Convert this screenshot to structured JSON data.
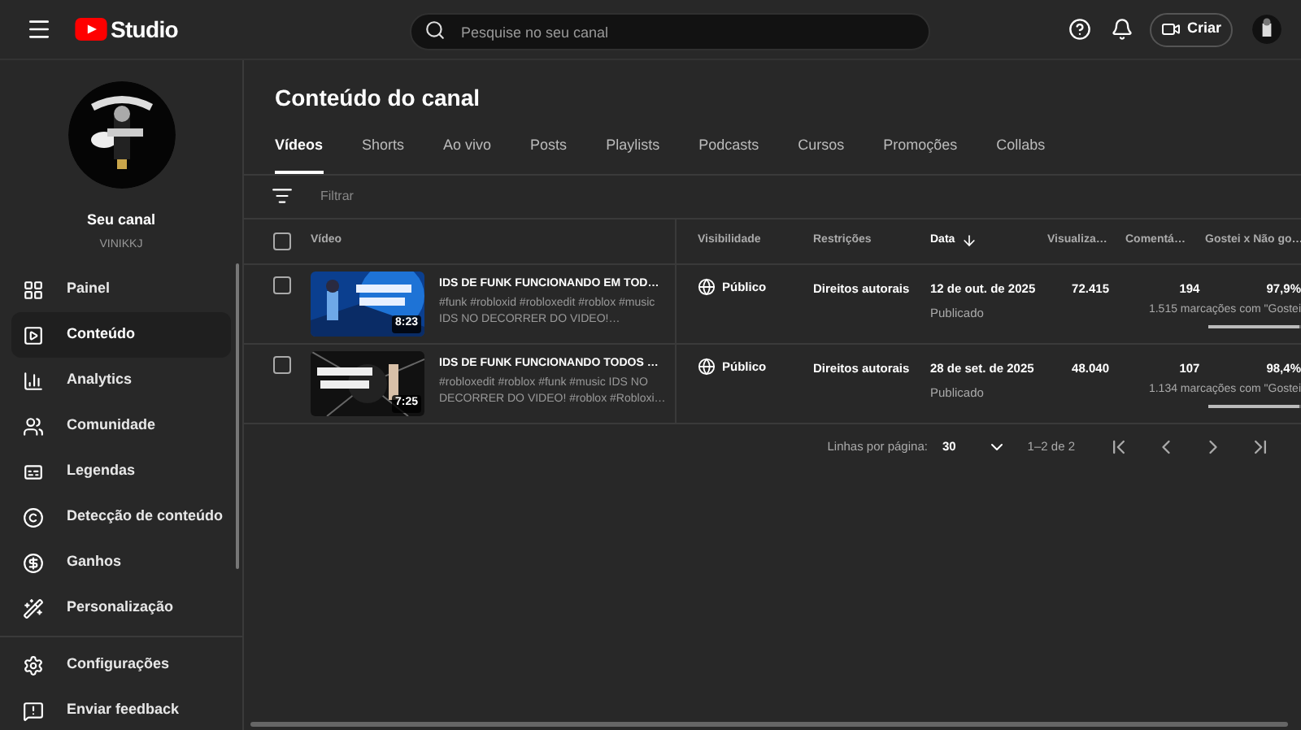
{
  "topbar": {
    "brand": "Studio",
    "search": {
      "placeholder": "Pesquise no seu canal"
    },
    "create_button": "Criar"
  },
  "channel": {
    "title": "Seu canal",
    "handle": "VINIKKJ"
  },
  "sidebar": {
    "items": [
      {
        "label": "Painel",
        "selected": false
      },
      {
        "label": "Conteúdo",
        "selected": true
      },
      {
        "label": "Analytics",
        "selected": false
      },
      {
        "label": "Comunidade",
        "selected": false
      },
      {
        "label": "Legendas",
        "selected": false
      },
      {
        "label": "Detecção de conteúdo",
        "selected": false
      },
      {
        "label": "Ganhos",
        "selected": false
      },
      {
        "label": "Personalização",
        "selected": false
      }
    ],
    "footer_items": [
      {
        "label": "Configurações"
      },
      {
        "label": "Enviar feedback"
      }
    ]
  },
  "page_title": "Conteúdo do canal",
  "tabs": [
    {
      "label": "Vídeos",
      "selected": true
    },
    {
      "label": "Shorts",
      "selected": false
    },
    {
      "label": "Ao vivo",
      "selected": false
    },
    {
      "label": "Posts",
      "selected": false
    },
    {
      "label": "Playlists",
      "selected": false
    },
    {
      "label": "Podcasts",
      "selected": false
    },
    {
      "label": "Cursos",
      "selected": false
    },
    {
      "label": "Promoções",
      "selected": false
    },
    {
      "label": "Collabs",
      "selected": false
    }
  ],
  "filter": {
    "placeholder": "Filtrar"
  },
  "table": {
    "select_all": {
      "checked": false
    },
    "columns": [
      {
        "label": "Vídeo",
        "sorted": false
      },
      {
        "label": "Visibilidade",
        "sorted": false
      },
      {
        "label": "Restrições",
        "sorted": false
      },
      {
        "label": "Data",
        "sorted": true
      },
      {
        "label": "Visualiza…",
        "sorted": false
      },
      {
        "label": "Comentá…",
        "sorted": false
      },
      {
        "label": "Gostei x Não go…",
        "sorted": false
      }
    ],
    "rows": [
      {
        "checked": false,
        "duration": "8:23",
        "title": "IDS DE FUNK FUNCIONANDO EM TOD…",
        "description": "#funk #robloxid #robloxedit #roblox #music IDS NO DECORRER DO VIDEO!…",
        "visibility": "Público",
        "restriction": "Direitos autorais",
        "date": "12 de out. de 2025",
        "status": "Publicado",
        "views": "72.415",
        "comments": "194",
        "like_ratio": "97,9%",
        "like_count": "1.515 marcações com \"Gostei",
        "level": 0.979
      },
      {
        "checked": false,
        "duration": "7:25",
        "title": "IDS DE FUNK FUNCIONANDO TODOS …",
        "description": "#robloxedit #roblox #funk #music IDS NO DECORRER DO VIDEO! #roblox #Robloxi…",
        "visibility": "Público",
        "restriction": "Direitos autorais",
        "date": "28 de set. de 2025",
        "status": "Publicado",
        "views": "48.040",
        "comments": "107",
        "like_ratio": "98,4%",
        "like_count": "1.134 marcações com \"Gostei",
        "level": 0.984
      }
    ]
  },
  "pagination": {
    "label": "Linhas por página:",
    "rows_per_page": "30",
    "range": "1–2 de 2"
  }
}
